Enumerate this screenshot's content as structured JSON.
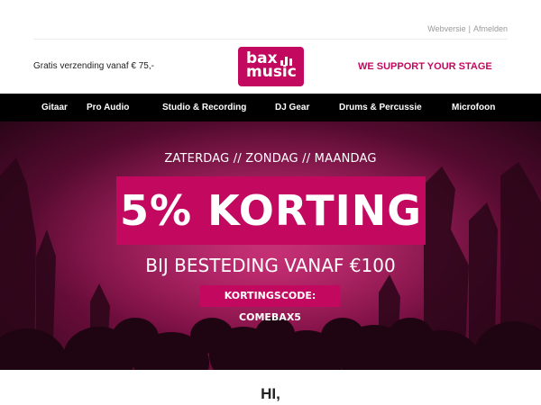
{
  "header": {
    "links": {
      "webversion": "Webversie",
      "separator": "|",
      "unsubscribe": "Afmelden"
    },
    "shipping": "Gratis verzending vanaf € 75,-",
    "logo": {
      "line1": "bax",
      "line2": "music"
    },
    "slogan": "WE SUPPORT YOUR STAGE"
  },
  "nav": {
    "items": [
      {
        "label": "Gitaar"
      },
      {
        "label": "Pro Audio"
      },
      {
        "label": "Studio & Recording"
      },
      {
        "label": "DJ Gear"
      },
      {
        "label": "Drums & Percussie"
      },
      {
        "label": "Microfoon"
      }
    ]
  },
  "hero": {
    "days": "ZATERDAG // ZONDAG // MAANDAG",
    "headline": "5% KORTING",
    "condition": "BIJ BESTEDING VANAF €100",
    "code": "KORTINGSCODE: COMEBAX5"
  },
  "body": {
    "greeting": "HI,"
  },
  "colors": {
    "brand": "#c2095f",
    "nav_bg": "#000000",
    "muted": "#9a9a9a"
  }
}
